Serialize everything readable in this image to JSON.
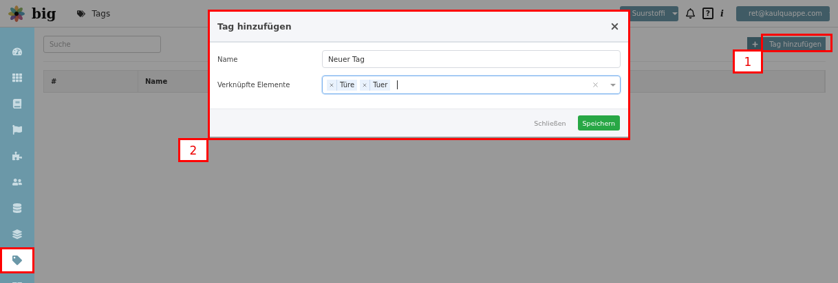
{
  "header": {
    "brand": "big",
    "breadcrumb": "Tags",
    "org_menu": "Suurstoffi",
    "help": "?",
    "info": "i",
    "user_menu": "ret@kaulquappe.com"
  },
  "sidebar": {
    "items": [
      {
        "selected": false,
        "highlighted": false
      },
      {
        "selected": false,
        "highlighted": false
      },
      {
        "selected": false,
        "highlighted": false
      },
      {
        "selected": false,
        "highlighted": false
      },
      {
        "selected": false,
        "highlighted": false
      },
      {
        "selected": false,
        "highlighted": false
      },
      {
        "selected": false,
        "highlighted": false
      },
      {
        "selected": false,
        "highlighted": false
      },
      {
        "selected": true,
        "highlighted": true
      },
      {
        "selected": false,
        "highlighted": false
      }
    ]
  },
  "toolbar": {
    "search": {
      "placeholder": "Suche"
    },
    "add_button": {
      "label": "Tag hinzufügen",
      "highlighted": true,
      "callout": "1"
    }
  },
  "table": {
    "columns": [
      "#",
      "Name"
    ]
  },
  "dialog": {
    "title": "Tag hinzufügen",
    "highlighted": true,
    "callout": "2",
    "fields": [
      {
        "kind": "text",
        "label": "Name",
        "value": "Neuer Tag"
      },
      {
        "kind": "multiselect",
        "label": "Verknüpfte Elemente",
        "focused": true,
        "chips": [
          "Türe",
          "Tuer"
        ]
      }
    ],
    "buttons": [
      {
        "kind": "link",
        "label": "Schließen"
      },
      {
        "kind": "primary",
        "label": "Speichern"
      }
    ]
  }
}
